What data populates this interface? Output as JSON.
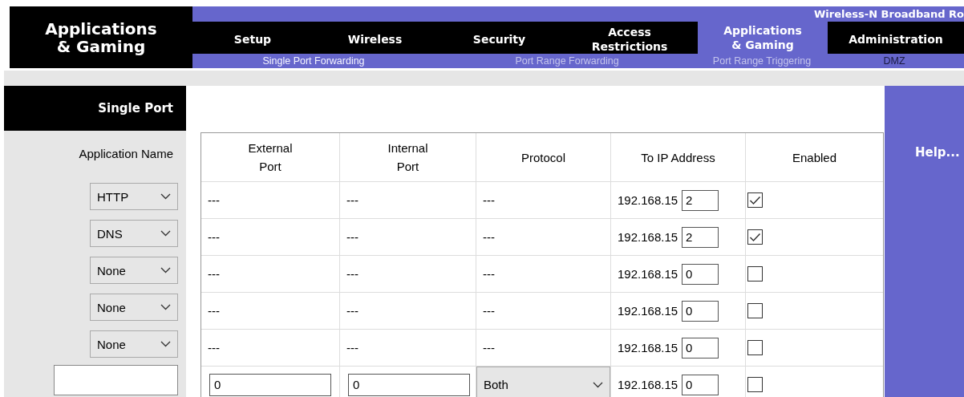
{
  "header": {
    "section_title": "Applications\n& Gaming",
    "product": "Wireless-N Broadband Ro",
    "tabs": [
      {
        "label": "Setup",
        "selected": false
      },
      {
        "label": "Wireless",
        "selected": false
      },
      {
        "label": "Security",
        "selected": false
      },
      {
        "label": "Access\nRestrictions",
        "selected": false
      },
      {
        "label": "Applications\n& Gaming",
        "selected": true
      },
      {
        "label": "Administration",
        "selected": false
      }
    ],
    "subtabs": [
      {
        "label": "Single Port Forwarding",
        "color": "#f4f4ff"
      },
      {
        "label": "Port Range Forwarding",
        "color": "#c4c4ec"
      },
      {
        "label": "Port Range Triggering",
        "color": "#c4c4ec"
      },
      {
        "label": "DMZ",
        "color": "#1a1a40"
      }
    ]
  },
  "sidebar": {
    "title": "Single Port",
    "column_label": "Application Name",
    "applications": [
      "HTTP",
      "DNS",
      "None",
      "None",
      "None"
    ]
  },
  "help": {
    "label": "Help..."
  },
  "table": {
    "columns": [
      "External\nPort",
      "Internal\nPort",
      "Protocol",
      "To IP Address",
      "Enabled"
    ],
    "rows": [
      {
        "kind": "preset",
        "external": "---",
        "internal": "---",
        "protocol": "---",
        "ip_prefix": "192.168.15",
        "ip_last": "2",
        "checked": true
      },
      {
        "kind": "preset",
        "external": "---",
        "internal": "---",
        "protocol": "---",
        "ip_prefix": "192.168.15",
        "ip_last": "2",
        "checked": true
      },
      {
        "kind": "preset",
        "external": "---",
        "internal": "---",
        "protocol": "---",
        "ip_prefix": "192.168.15",
        "ip_last": "0",
        "checked": false
      },
      {
        "kind": "preset",
        "external": "---",
        "internal": "---",
        "protocol": "---",
        "ip_prefix": "192.168.15",
        "ip_last": "0",
        "checked": false
      },
      {
        "kind": "preset",
        "external": "---",
        "internal": "---",
        "protocol": "---",
        "ip_prefix": "192.168.15",
        "ip_last": "0",
        "checked": false
      },
      {
        "kind": "custom",
        "external": "0",
        "internal": "0",
        "protocol": "Both",
        "ip_prefix": "192.168.15",
        "ip_last": "0",
        "checked": false
      }
    ]
  }
}
